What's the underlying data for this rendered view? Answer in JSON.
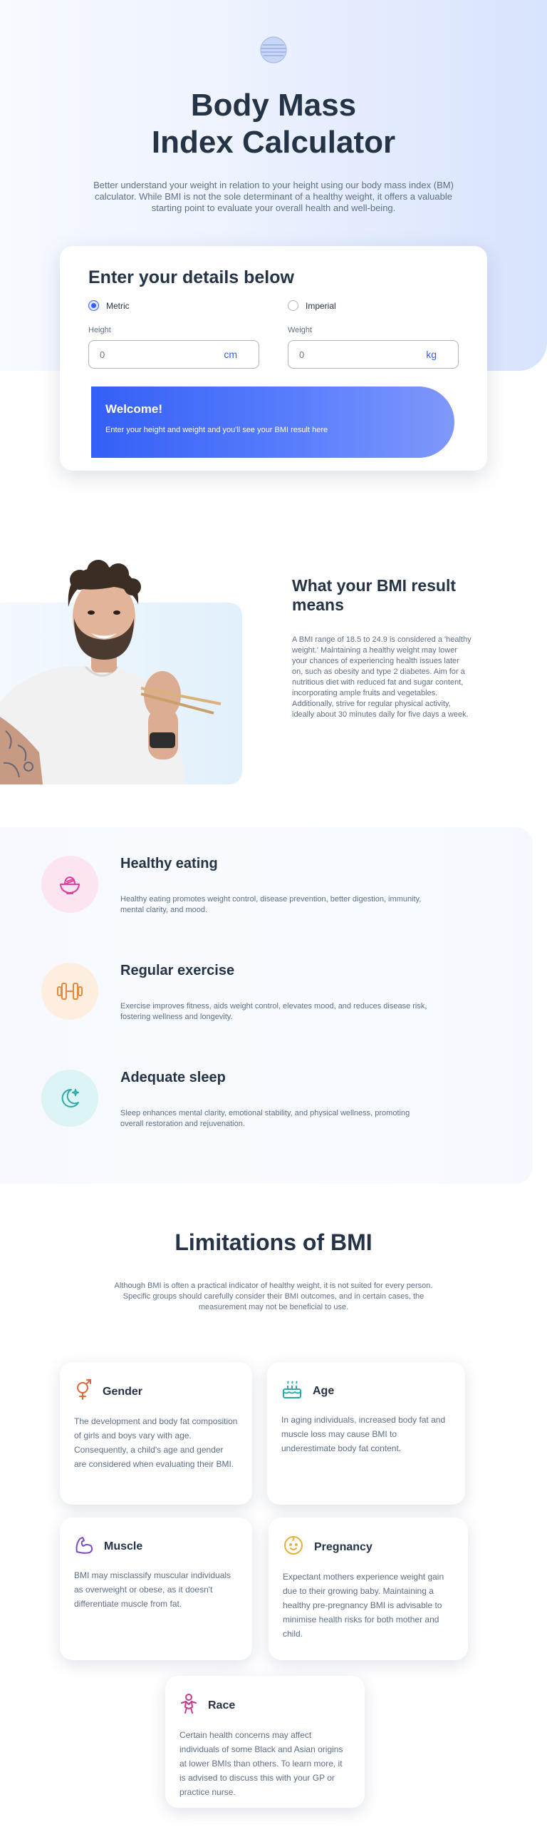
{
  "hero": {
    "logo_icon": "globe-icon",
    "title_line1": "Body Mass",
    "title_line2": "Index Calculator",
    "description": "Better understand your weight in relation to your height using our body mass index (BM) calculator. While BMI is not the sole determinant of a healthy weight, it offers a valuable starting point to evaluate your overall health and well-being."
  },
  "calculator": {
    "title": "Enter your details below",
    "units": [
      {
        "label": "Metric",
        "selected": true
      },
      {
        "label": "Imperial",
        "selected": false
      }
    ],
    "height": {
      "label": "Height",
      "placeholder": "0",
      "unit": "cm"
    },
    "weight": {
      "label": "Weight",
      "placeholder": "0",
      "unit": "kg"
    },
    "result": {
      "title": "Welcome!",
      "text": "Enter your height and weight and you'll see your BMI result here"
    }
  },
  "meaning": {
    "title": "What your BMI result means",
    "text": "A BMI range of 18.5 to 24.9 is considered a 'healthy weight.' Maintaining a healthy weight may lower your chances of experiencing health issues later on, such as obesity and type 2 diabetes. Aim for a nutritious diet with reduced fat and sugar content, incorporating ample fruits and vegetables. Additionally, strive for regular physical activity, ideally about 30 minutes daily for five days a week."
  },
  "tips": [
    {
      "icon": "bowl-icon",
      "color": "#e0409b",
      "title": "Healthy eating",
      "text": "Healthy eating promotes weight control, disease prevention, better digestion, immunity, mental clarity, and mood."
    },
    {
      "icon": "dumbbell-icon",
      "color": "#e5893a",
      "title": "Regular exercise",
      "text": "Exercise improves fitness, aids weight control, elevates mood, and reduces disease risk, fostering wellness and longevity."
    },
    {
      "icon": "moon-icon",
      "color": "#2fa9a9",
      "title": "Adequate sleep",
      "text": "Sleep enhances mental clarity, emotional stability, and physical wellness, promoting overall restoration and rejuvenation."
    }
  ],
  "limitations": {
    "title": "Limitations of BMI",
    "text": "Although BMI is often a practical indicator of healthy weight, it is not suited for every person. Specific groups should carefully consider their BMI outcomes, and in certain cases, the measurement may not be beneficial to use.",
    "cards": [
      {
        "icon": "gender-icon",
        "title": "Gender",
        "text": "The development and body fat composition of girls and boys vary with age. Consequently, a child's age and gender are considered when evaluating their BMI."
      },
      {
        "icon": "birthday-cake-icon",
        "title": "Age",
        "text": "In aging individuals, increased body fat and muscle loss may cause BMI to underestimate body fat content."
      },
      {
        "icon": "flexed-arm-icon",
        "title": "Muscle",
        "text": "BMI may misclassify muscular individuals as overweight or obese, as it doesn't differentiate muscle from fat."
      },
      {
        "icon": "baby-face-icon",
        "title": "Pregnancy",
        "text": "Expectant mothers experience weight gain due to their growing baby. Maintaining a healthy pre-pregnancy BMI is advisable to minimise health risks for both mother and child."
      },
      {
        "icon": "person-icon",
        "title": "Race",
        "text": "Certain health concerns may affect individuals of some Black and Asian origins at lower BMIs than others. To learn more, it is advised to discuss this with your GP or practice nurse."
      }
    ]
  },
  "colors": {
    "accent": "#345ff6",
    "heading": "#253347",
    "body_text": "#5d6f88"
  }
}
